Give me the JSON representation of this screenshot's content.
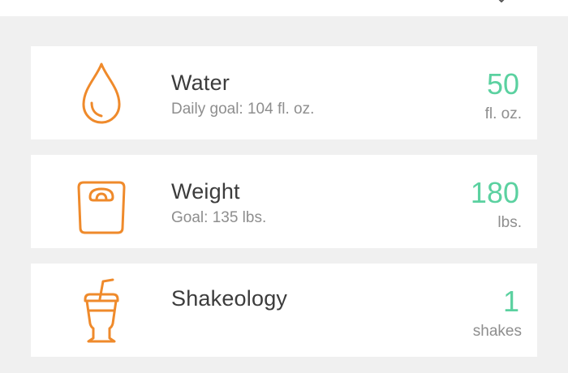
{
  "theme": {
    "accent_orange": "#ef8a2b",
    "value_green": "#5bd1a0",
    "background": "#f0f0f0"
  },
  "trackers": [
    {
      "name": "Water",
      "goal_text": "Daily goal: 104 fl. oz.",
      "value": "50",
      "unit": "fl. oz.",
      "icon": "water-drop-icon"
    },
    {
      "name": "Weight",
      "goal_text": "Goal: 135 lbs.",
      "value": "180",
      "unit": "lbs.",
      "icon": "scale-icon"
    },
    {
      "name": "Shakeology",
      "goal_text": "",
      "value": "1",
      "unit": "shakes",
      "icon": "shake-glass-icon"
    }
  ]
}
